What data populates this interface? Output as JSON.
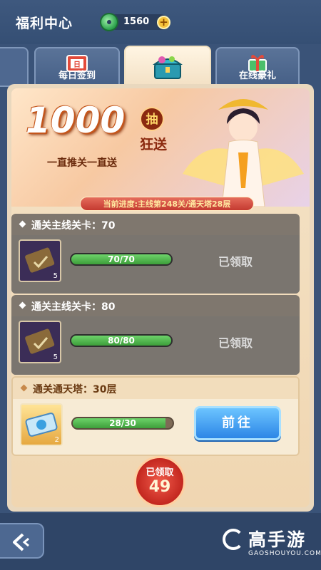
{
  "header": {
    "title": "福利中心",
    "currency_amount": "1560",
    "currency_icon": "jade-coin-icon",
    "add_icon": "plus-icon"
  },
  "tabs": [
    {
      "label": "每日签到",
      "icon": "calendar-icon"
    },
    {
      "label": "",
      "icon": "treasure-chest-icon",
      "active": true
    },
    {
      "label": "在线豪礼",
      "icon": "gift-icon"
    }
  ],
  "banner": {
    "big_number": "1000",
    "badge": "抽",
    "kuang": "狂送",
    "subtitle": "一直推关一直送",
    "progress": "当前进度:主线第248关/通天塔28层"
  },
  "tasks": [
    {
      "title": "通关主线关卡：70",
      "item_count": "5",
      "progress_text": "70/70",
      "progress_fraction": 1.0,
      "status": "已领取",
      "state": "done"
    },
    {
      "title": "通关主线关卡：80",
      "item_count": "5",
      "progress_text": "80/80",
      "progress_fraction": 1.0,
      "status": "已领取",
      "state": "done"
    },
    {
      "title": "通关通天塔：30层",
      "item_count": "2",
      "progress_text": "28/30",
      "progress_fraction": 0.93,
      "button": "前往",
      "state": "active"
    }
  ],
  "claimed": {
    "label": "已领取",
    "count": "49"
  },
  "watermark": {
    "cn": "高手游",
    "en": "GAOSHOUYOU.COM"
  },
  "colors": {
    "bar_green": "#4fb84a",
    "go_blue": "#2c86e6",
    "claimed_red": "#d3342a",
    "panel": "#f0d6b1"
  }
}
